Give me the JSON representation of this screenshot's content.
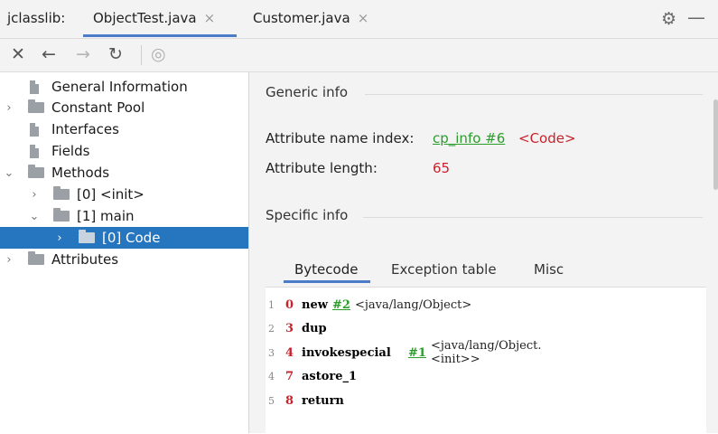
{
  "titlebar": {
    "tool_label": "jclasslib:",
    "tabs": [
      {
        "label": "ObjectTest.java",
        "close": "×"
      },
      {
        "label": "Customer.java",
        "close": "×"
      }
    ],
    "gear_icon": "⚙",
    "minimize_icon": "—"
  },
  "toolbar": {
    "close": "✕",
    "back": "←",
    "forward": "→",
    "refresh": "↻",
    "web": "◎"
  },
  "tree": {
    "items": [
      {
        "label": "General Information",
        "icon": "file-icon",
        "chevron": ""
      },
      {
        "label": "Constant Pool",
        "icon": "folder-icon",
        "chevron": "›"
      },
      {
        "label": "Interfaces",
        "icon": "file-icon",
        "chevron": ""
      },
      {
        "label": "Fields",
        "icon": "file-icon",
        "chevron": ""
      },
      {
        "label": "Methods",
        "icon": "folder-icon",
        "chevron": "⌄"
      },
      {
        "label": "[0] <init>",
        "icon": "folder-icon",
        "chevron": "›"
      },
      {
        "label": "[1] main",
        "icon": "folder-icon",
        "chevron": "⌄"
      },
      {
        "label": "[0] Code",
        "icon": "folder-icon",
        "chevron": "›",
        "selected": true
      },
      {
        "label": "Attributes",
        "icon": "folder-icon",
        "chevron": "›"
      }
    ]
  },
  "generic": {
    "title": "Generic info",
    "name_index_label": "Attribute name index:",
    "name_index_link": "cp_info #6",
    "name_index_value": "<Code>",
    "length_label": "Attribute length:",
    "length_value": "65"
  },
  "specific": {
    "title": "Specific info",
    "tabs": [
      "Bytecode",
      "Exception table",
      "Misc"
    ]
  },
  "bytecode": [
    {
      "line": "1",
      "offset": "0",
      "op": "new",
      "cp": "#2",
      "comment": "<java/lang/Object>"
    },
    {
      "line": "2",
      "offset": "3",
      "op": "dup",
      "cp": "",
      "comment": ""
    },
    {
      "line": "3",
      "offset": "4",
      "op": "invokespecial",
      "cp": "#1",
      "comment": "<java/lang/Object.<init>>"
    },
    {
      "line": "4",
      "offset": "7",
      "op": "astore_1",
      "cp": "",
      "comment": ""
    },
    {
      "line": "5",
      "offset": "8",
      "op": "return",
      "cp": "",
      "comment": ""
    }
  ],
  "colors": {
    "accent": "#4a7cc7",
    "selection": "#2675bf",
    "link": "#2a9d2a",
    "value_red": "#c8222c"
  }
}
